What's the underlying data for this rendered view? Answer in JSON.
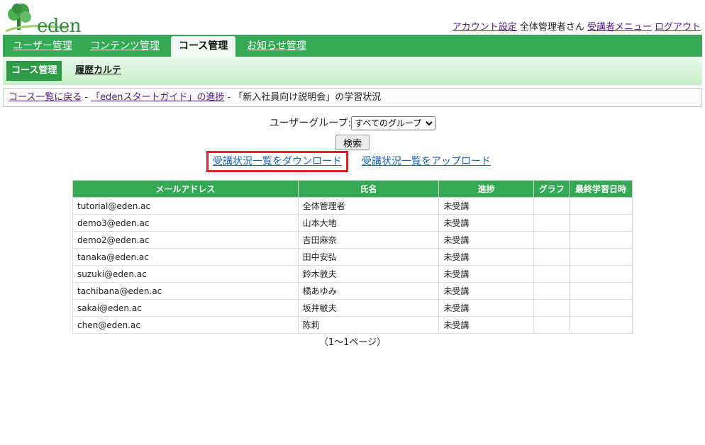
{
  "brand": {
    "name": "eden"
  },
  "header": {
    "account_settings": "アカウント設定",
    "user_label": "全体管理者さん",
    "student_menu": "受講者メニュー",
    "logout": "ログアウト"
  },
  "mainnav": {
    "tabs": [
      {
        "label": "ユーザー管理"
      },
      {
        "label": "コンテンツ管理"
      },
      {
        "label": "コース管理"
      },
      {
        "label": "お知らせ管理"
      }
    ]
  },
  "subnav": {
    "active": "コース管理",
    "history": "履歴カルテ"
  },
  "breadcrumb": {
    "back": "コース一覧に戻る",
    "sep": "-",
    "course": "「edenスタートガイド」の進捗",
    "current": "「新入社員向け説明会」の学習状況"
  },
  "filter": {
    "group_label": "ユーザーグループ:",
    "group_selected": "すべてのグループ",
    "search_button": "検索"
  },
  "actions": {
    "download": "受講状況一覧をダウンロード",
    "upload": "受講状況一覧をアップロード"
  },
  "table": {
    "headers": [
      "メールアドレス",
      "氏名",
      "進捗",
      "グラフ",
      "最終学習日時"
    ],
    "rows": [
      {
        "email": "tutorial@eden.ac",
        "name": "全体管理者",
        "progress": "未受講",
        "graph": "",
        "last": ""
      },
      {
        "email": "demo3@eden.ac",
        "name": "山本大地",
        "progress": "未受講",
        "graph": "",
        "last": ""
      },
      {
        "email": "demo2@eden.ac",
        "name": "吉田麻奈",
        "progress": "未受講",
        "graph": "",
        "last": ""
      },
      {
        "email": "tanaka@eden.ac",
        "name": "田中安弘",
        "progress": "未受講",
        "graph": "",
        "last": ""
      },
      {
        "email": "suzuki@eden.ac",
        "name": "鈴木敦夫",
        "progress": "未受講",
        "graph": "",
        "last": ""
      },
      {
        "email": "tachibana@eden.ac",
        "name": "橘あゆみ",
        "progress": "未受講",
        "graph": "",
        "last": ""
      },
      {
        "email": "sakai@eden.ac",
        "name": "坂井敏夫",
        "progress": "未受講",
        "graph": "",
        "last": ""
      },
      {
        "email": "chen@eden.ac",
        "name": "陈莉",
        "progress": "未受講",
        "graph": "",
        "last": ""
      }
    ]
  },
  "pager": {
    "text": "（1～1ページ）"
  },
  "colors": {
    "brand_green": "#34a853",
    "highlight_red": "#e0202a",
    "link_blue": "#1a62b5"
  }
}
